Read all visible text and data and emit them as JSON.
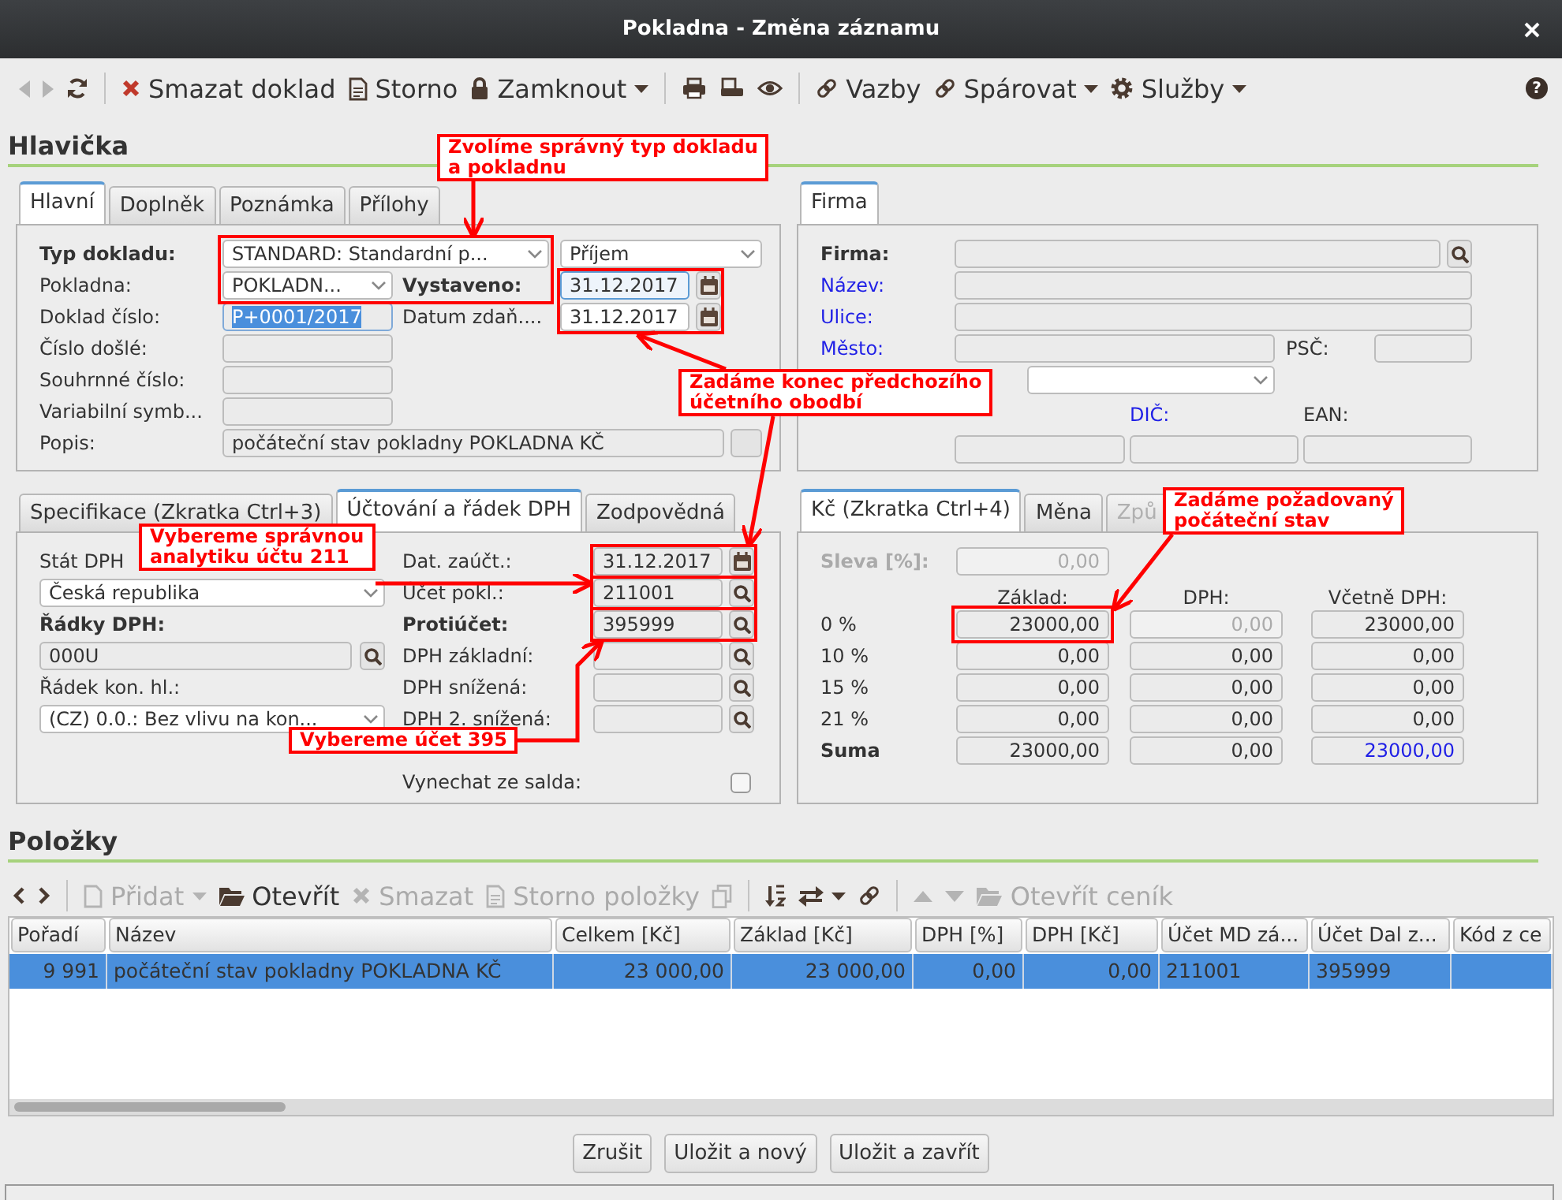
{
  "window": {
    "title": "Pokladna - Změna záznamu"
  },
  "toolbar": {
    "groups": [
      [
        {
          "kind": "back",
          "disabled": true
        },
        {
          "kind": "forward",
          "disabled": true
        },
        {
          "kind": "refresh",
          "disabled": false
        }
      ],
      [
        {
          "kind": "delete",
          "label": "Smazat doklad",
          "menu": false,
          "disabled": false
        },
        {
          "kind": "cancel",
          "label": "Storno",
          "menu": false,
          "disabled": false
        },
        {
          "kind": "lock",
          "label": "Zamknout",
          "menu": true,
          "disabled": false
        }
      ],
      [
        {
          "kind": "print",
          "disabled": false
        },
        {
          "kind": "print-setup",
          "disabled": false
        },
        {
          "kind": "preview",
          "disabled": false
        }
      ],
      [
        {
          "kind": "links",
          "label": "Vazby",
          "menu": false,
          "disabled": false
        },
        {
          "kind": "pair",
          "label": "Spárovat",
          "menu": true,
          "disabled": false
        },
        {
          "kind": "settings",
          "label": "Služby",
          "menu": true,
          "disabled": false
        }
      ]
    ],
    "help": "?"
  },
  "header": {
    "title": "Hlavička",
    "tabs": [
      {
        "label": "Hlavní",
        "selected": true
      },
      {
        "label": "Doplněk",
        "selected": false
      },
      {
        "label": "Poznámka",
        "selected": false
      },
      {
        "label": "Přílohy",
        "selected": false
      }
    ],
    "document_type": {
      "label": "Typ dokladu:",
      "required": true,
      "value": "STANDARD: Standardní p...",
      "direction": "Příjem"
    },
    "cash_desk": {
      "label": "Pokladna:",
      "required": false,
      "value": "POKLADN..."
    },
    "dates": [
      {
        "label": "Vystaveno:",
        "required": true,
        "value": "31.12.2017",
        "focused": true
      },
      {
        "label": "Datum zdaň....",
        "required": false,
        "value": "31.12.2017",
        "focused": false
      }
    ],
    "fields": [
      {
        "label": "Doklad číslo:",
        "required": false,
        "value": "P+0001/2017",
        "selected": true
      },
      {
        "label": "Číslo došlé:",
        "required": false,
        "selected": false
      },
      {
        "label": "Souhrnné číslo:",
        "required": false,
        "selected": false
      },
      {
        "label": "Variabilní symb...",
        "required": false,
        "selected": false
      },
      {
        "label": "Popis:",
        "required": false,
        "value": "počáteční stav pokladny POKLADNA KČ",
        "selected": false
      }
    ]
  },
  "partner": {
    "tabs": [
      {
        "label": "Firma",
        "selected": true
      }
    ],
    "fields": [
      {
        "label": "Firma:",
        "required": true,
        "linked": false
      },
      {
        "label": "Název:",
        "required": false,
        "linked": true
      },
      {
        "label": "Ulice:",
        "required": false,
        "linked": true
      },
      {
        "label": "Město:",
        "required": false,
        "linked": true
      },
      {
        "label": "PSČ:",
        "required": false,
        "linked": false
      },
      {
        "label": "DIČ:",
        "required": false,
        "linked": true
      },
      {
        "label": "EAN:",
        "required": false,
        "linked": false
      }
    ]
  },
  "accounting": {
    "tabs": [
      {
        "label": "Specifikace (Zkratka Ctrl+3)",
        "selected": false
      },
      {
        "label": "Účtování a řádek DPH",
        "selected": true
      },
      {
        "label": "Zodpovědná",
        "selected": false
      }
    ],
    "left": [
      {
        "kind": "label",
        "text": "Stát DPH",
        "required": false
      },
      {
        "kind": "select",
        "value": "Česká republika"
      },
      {
        "kind": "label",
        "text": "Řádky DPH:",
        "required": true
      },
      {
        "kind": "lookup",
        "value": "000U"
      },
      {
        "kind": "label",
        "text": "Řádek kon. hl.:",
        "required": false
      },
      {
        "kind": "select",
        "value": "(CZ) 0.0.: Bez vlivu na kon..."
      }
    ],
    "right": [
      {
        "kind": "date",
        "label": "Dat. zaúčt.:",
        "required": false,
        "value": "31.12.2017"
      },
      {
        "kind": "lookup",
        "label": "Účet pokl.:",
        "required": false,
        "value": "211001"
      },
      {
        "kind": "lookup",
        "label": "Protiúčet:",
        "required": true,
        "value": "395999"
      },
      {
        "kind": "lookup",
        "label": "DPH základní:",
        "required": false
      },
      {
        "kind": "lookup",
        "label": "DPH snížená:",
        "required": false
      },
      {
        "kind": "lookup",
        "label": "DPH 2. snížená:",
        "required": false
      }
    ],
    "exclude": {
      "label": "Vynechat ze salda:",
      "checked": false
    }
  },
  "amounts": {
    "tabs": [
      {
        "label": "Kč (Zkratka Ctrl+4)",
        "selected": true,
        "disabled": false
      },
      {
        "label": "Měna",
        "selected": false,
        "disabled": false
      },
      {
        "label": "Způ",
        "selected": false,
        "disabled": true
      }
    ],
    "discount": {
      "label": "Sleva [%]:",
      "value": "0,00",
      "disabled": true
    },
    "columns": [
      "Základ:",
      "DPH:",
      "Včetně DPH:"
    ],
    "rows": [
      {
        "label": "0 %",
        "total": false,
        "cells": [
          {
            "value": "23000,00",
            "disabled": false,
            "linked": false
          },
          {
            "value": "0,00",
            "disabled": true,
            "linked": false
          },
          {
            "value": "23000,00",
            "disabled": false,
            "linked": false
          }
        ]
      },
      {
        "label": "10 %",
        "total": false,
        "cells": [
          {
            "value": "0,00",
            "disabled": false,
            "linked": false
          },
          {
            "value": "0,00",
            "disabled": false,
            "linked": false
          },
          {
            "value": "0,00",
            "disabled": false,
            "linked": false
          }
        ]
      },
      {
        "label": "15 %",
        "total": false,
        "cells": [
          {
            "value": "0,00",
            "disabled": false,
            "linked": false
          },
          {
            "value": "0,00",
            "disabled": false,
            "linked": false
          },
          {
            "value": "0,00",
            "disabled": false,
            "linked": false
          }
        ]
      },
      {
        "label": "21 %",
        "total": false,
        "cells": [
          {
            "value": "0,00",
            "disabled": false,
            "linked": false
          },
          {
            "value": "0,00",
            "disabled": false,
            "linked": false
          },
          {
            "value": "0,00",
            "disabled": false,
            "linked": false
          }
        ]
      },
      {
        "label": "Suma",
        "total": true,
        "cells": [
          {
            "value": "23000,00",
            "disabled": false,
            "linked": false
          },
          {
            "value": "0,00",
            "disabled": false,
            "linked": false
          },
          {
            "value": "23000,00",
            "disabled": false,
            "linked": true
          }
        ]
      }
    ]
  },
  "items": {
    "title": "Položky",
    "toolbar": {
      "groups": [
        [
          {
            "kind": "prev",
            "disabled": false
          },
          {
            "kind": "next",
            "disabled": false
          }
        ],
        [
          {
            "kind": "add",
            "label": "Přidat",
            "menu": true,
            "disabled": true
          },
          {
            "kind": "open",
            "label": "Otevřít",
            "menu": false,
            "disabled": false
          },
          {
            "kind": "delete",
            "label": "Smazat",
            "menu": false,
            "disabled": true
          },
          {
            "kind": "cancel",
            "label": "Storno položky",
            "menu": false,
            "disabled": true
          },
          {
            "kind": "copy",
            "disabled": true
          }
        ],
        [
          {
            "kind": "sort",
            "disabled": false
          },
          {
            "kind": "swap",
            "menu": true,
            "disabled": false
          },
          {
            "kind": "links",
            "disabled": false
          }
        ],
        [
          {
            "kind": "up",
            "disabled": true
          },
          {
            "kind": "down",
            "disabled": true
          },
          {
            "kind": "open",
            "label": "Otevřít ceník",
            "menu": false,
            "disabled": true
          }
        ]
      ]
    },
    "table": {
      "columns": [
        "Pořadí",
        "Název",
        "Celkem [Kč]",
        "Základ [Kč]",
        "DPH [%]",
        "DPH [Kč]",
        "Účet MD zá...",
        "Účet Dal z...",
        "Kód z ce"
      ],
      "rows": [
        {
          "selected": true,
          "cells": [
            "9 991",
            "počáteční stav pokladny POKLADNA KČ",
            "23 000,00",
            "23 000,00",
            "0,00",
            "0,00",
            "211001",
            "395999"
          ]
        }
      ]
    }
  },
  "buttons": [
    {
      "label": "Zrušit"
    },
    {
      "label": "Uložit a nový"
    },
    {
      "label": "Uložit a zavřít"
    }
  ],
  "annotations": [
    {
      "lines": [
        "Zvolíme správný typ dokladu",
        "a pokladnu"
      ]
    },
    {
      "lines": [
        "Zadáme konec předchozího",
        "účetního obodbí"
      ]
    },
    {
      "lines": [
        "Vybereme správnou",
        "analytiku účtu 211"
      ]
    },
    {
      "lines": [
        "Vybereme účet 395"
      ]
    },
    {
      "lines": [
        "Zadáme požadovaný",
        "počáteční stav"
      ]
    }
  ]
}
